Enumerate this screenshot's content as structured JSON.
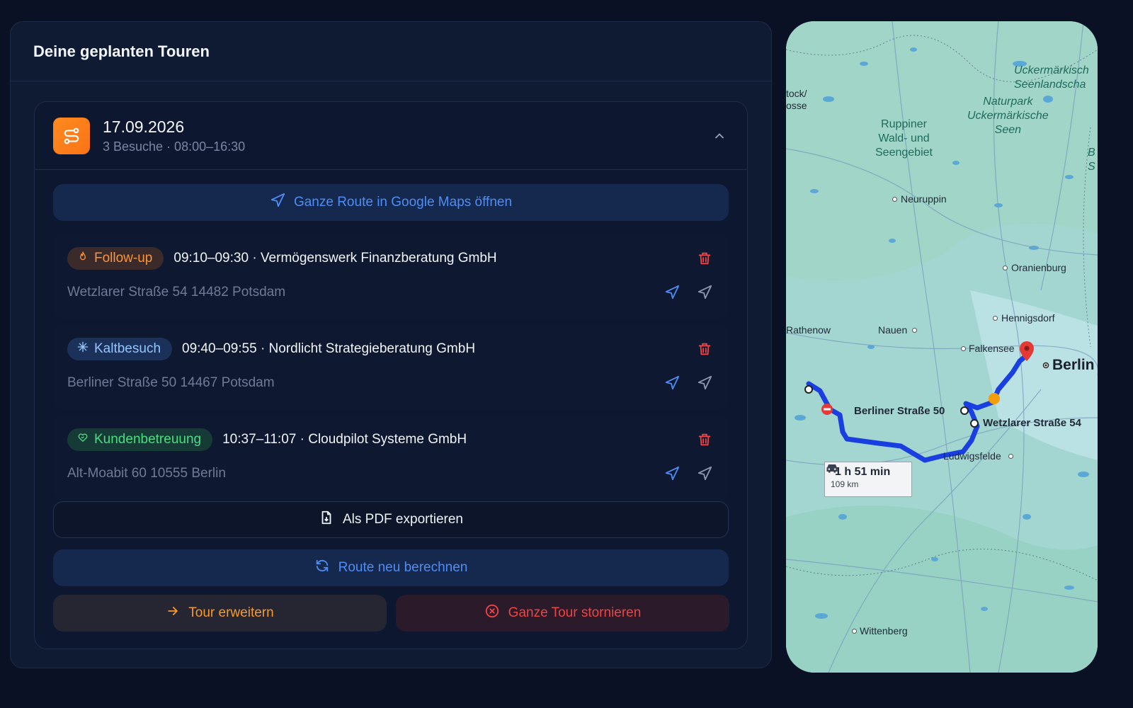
{
  "panel": {
    "title": "Deine geplanten Touren"
  },
  "tour": {
    "date": "17.09.2026",
    "summary": "3 Besuche · 08:00–16:30",
    "open_maps_label": "Ganze Route in Google Maps öffnen",
    "visits": [
      {
        "badge": "Follow-up",
        "badge_type": "follow-up",
        "badge_icon": "flame-icon",
        "title": "09:10–09:30 · Vermögenswerk Finanzberatung GmbH",
        "address": "Wetzlarer Straße 54 14482 Potsdam"
      },
      {
        "badge": "Kaltbesuch",
        "badge_type": "cold",
        "badge_icon": "snowflake-icon",
        "title": "09:40–09:55 · Nordlicht Strategieberatung GmbH",
        "address": "Berliner Straße 50 14467 Potsdam"
      },
      {
        "badge": "Kundenbetreuung",
        "badge_type": "care",
        "badge_icon": "heart-handshake-icon",
        "title": "10:37–11:07 · Cloudpilot Systeme GmbH",
        "address": "Alt-Moabit 60 10555 Berlin"
      }
    ],
    "export_pdf_label": "Als PDF exportieren",
    "recalc_label": "Route neu berechnen",
    "extend_label": "Tour erweitern",
    "cancel_label": "Ganze Tour stornieren"
  },
  "map": {
    "labels": {
      "rostock": "tock/\nosse",
      "uckermark_lakes": "Uckermärkisch\nSeenlandscha",
      "naturpark": "Naturpark\nUckermärkische\nSeen",
      "ruppiner": "Ruppiner\nWald- und\nSeengebiet",
      "neuruppin": "Neuruppin",
      "oranienburg": "Oranienburg",
      "hennigsdorf": "Hennigsdorf",
      "rathenow": "Rathenow",
      "nauen": "Nauen",
      "falkensee": "Falkensee",
      "berlin": "Berlin",
      "berliner_strasse": "Berliner Straße 50",
      "wetzlarer_strasse": "Wetzlarer Straße 54",
      "ludwigsfelde": "Ludwigsfelde",
      "wittenberg": "Wittenberg",
      "edge_b": "B",
      "edge_s": "S"
    },
    "route": {
      "duration": "1 h 51 min",
      "distance": "109 km"
    }
  },
  "colors": {
    "accent_blue": "#4f8df5",
    "orange": "#f97316",
    "danger": "#ef4444",
    "green": "#4ade80",
    "route": "#1a3fe0"
  }
}
